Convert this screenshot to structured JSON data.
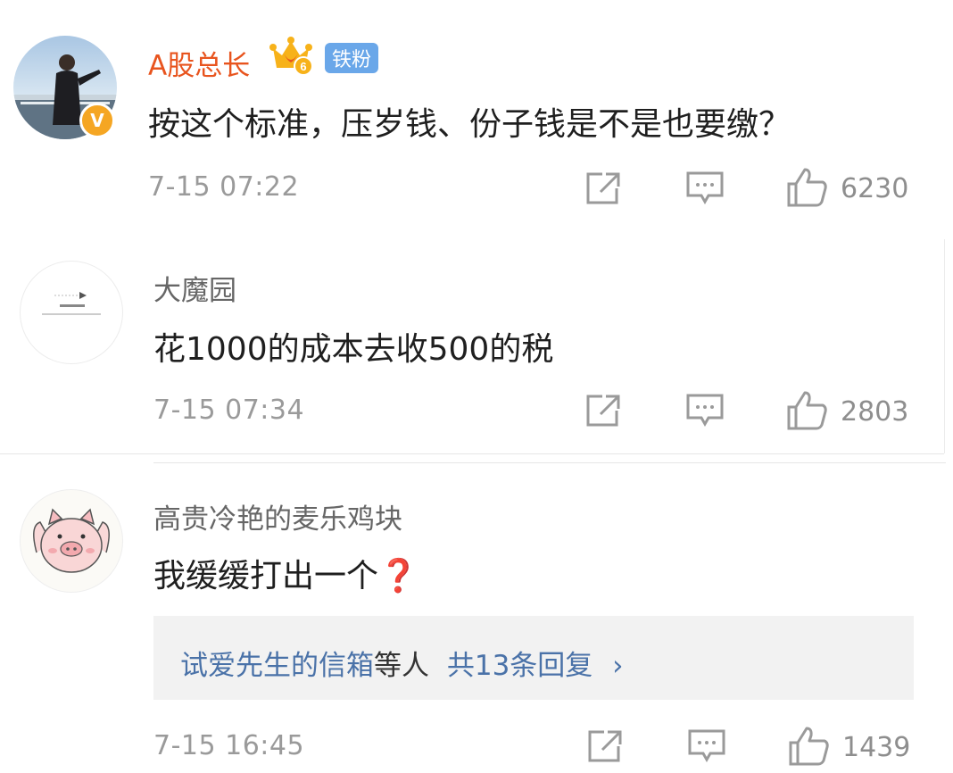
{
  "comments": [
    {
      "user": "A股总长",
      "fan_badge": "铁粉",
      "verified": "V",
      "text": "按这个标准，压岁钱、份子钱是不是也要缴？",
      "time": "7-15 07:22",
      "likes": "6230"
    },
    {
      "user": "大魔园",
      "text": "花1000的成本去收500的税",
      "time": "7-15 07:34",
      "likes": "2803"
    },
    {
      "user": "高贵冷艳的麦乐鸡块",
      "text": "我缓缓打出一个❓",
      "time": "7-15 16:45",
      "likes": "1439",
      "replies": {
        "who": "试爱先生的信箱",
        "suffix": "等人",
        "count": "共13条回复",
        "chevron": "›"
      }
    }
  ],
  "colors": {
    "vip_name": "#e8541e",
    "reply_link": "#4a72a8",
    "meta": "#9a9a9a",
    "verified": "#f5a623",
    "fan_tag": "#6aa7e9"
  },
  "icons": [
    "share-icon",
    "comment-icon",
    "like-icon",
    "crown-badge-icon",
    "verified-icon"
  ]
}
